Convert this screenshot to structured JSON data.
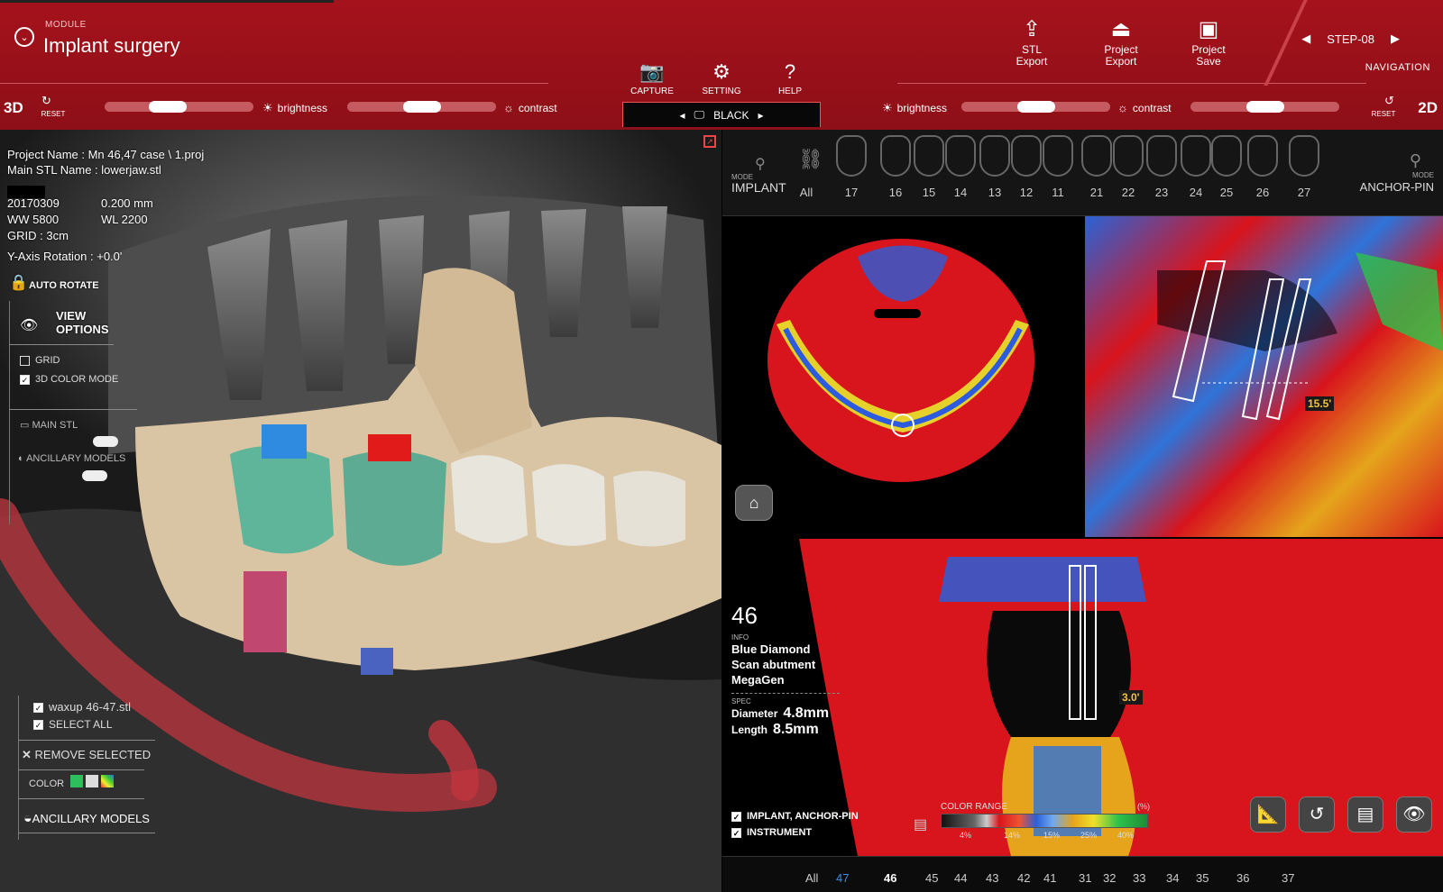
{
  "header": {
    "module_label": "MODULE",
    "module_title": "Implant surgery",
    "tools": {
      "capture": "CAPTURE",
      "setting": "SETTING",
      "help": "HELP",
      "stl_export_1": "STL",
      "stl_export_2": "Export",
      "project_export_1": "Project",
      "project_export_2": "Export",
      "project_save_1": "Project",
      "project_save_2": "Save"
    },
    "step": "STEP-08",
    "navigation": "NAVIGATION",
    "mode_3d": "3D",
    "mode_2d": "2D",
    "reset": "RESET",
    "brightness": "brightness",
    "contrast": "contrast",
    "background": "BLACK",
    "sliders": {
      "left_brightness": 0.4,
      "left_contrast": 0.5,
      "right_brightness": 0.5,
      "right_contrast": 0.5
    }
  },
  "view3d": {
    "project_name": "Project Name : Mn 46,47 case \\ 1.proj",
    "main_stl_name": "Main STL Name : lowerjaw.stl",
    "date": "20170309",
    "voxel": "0.200 mm",
    "ww": "WW 5800",
    "wl": "WL 2200",
    "grid": "GRID : 3cm",
    "rotation": "Y-Axis Rotation : +0.0'",
    "auto_rotate": "AUTO ROTATE",
    "view_options_1": "VIEW",
    "view_options_2": "OPTIONS",
    "grid_option": "GRID",
    "color_mode": "3D COLOR MODE",
    "main_stl": "MAIN STL",
    "ancillary_models": "ANCILLARY MODELS",
    "waxup_file": "waxup 46-47.stl",
    "select_all": "SELECT ALL",
    "remove_selected": "REMOVE SELECTED",
    "color": "COLOR",
    "ancillary_models_btn": "ANCILLARY MODELS"
  },
  "tooth_bar": {
    "mode_label": "MODE",
    "mode_value": "IMPLANT",
    "all": "All",
    "teeth": [
      "17",
      "16",
      "15",
      "14",
      "13",
      "12",
      "11",
      "21",
      "22",
      "23",
      "24",
      "25",
      "26",
      "27"
    ],
    "right_mode_value": "ANCHOR-PIN"
  },
  "implant_info": {
    "tooth": "46",
    "info_label": "INFO",
    "line1": "Blue Diamond",
    "line2": "Scan abutment",
    "line3": "MegaGen",
    "spec_label": "SPEC",
    "diameter_label": "Diameter",
    "diameter_value": "4.8mm",
    "length_label": "Length",
    "length_value": "8.5mm"
  },
  "angles": {
    "sagittal": "15.5'",
    "coronal": "3.0'"
  },
  "overlay": {
    "implant_anchor": "IMPLANT, ANCHOR-PIN",
    "instrument": "INSTRUMENT",
    "color_range": "COLOR RANGE",
    "percent_symbol": "(%)",
    "ticks": [
      "4%",
      "14%",
      "15%",
      "25%",
      "40%"
    ]
  },
  "bottom_bar": {
    "all": "All",
    "teeth": [
      "47",
      "46",
      "45",
      "44",
      "43",
      "42",
      "41",
      "31",
      "32",
      "33",
      "34",
      "35",
      "36",
      "37"
    ]
  },
  "colors": {
    "accent": "#9d111a",
    "selected_tooth": "#3a8fe0",
    "scan_red": "#d8141c"
  }
}
